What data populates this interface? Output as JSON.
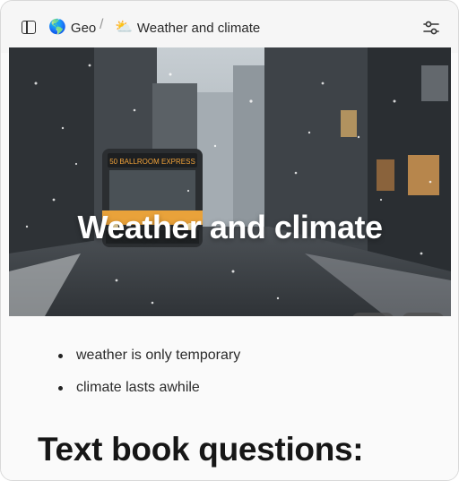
{
  "breadcrumb": {
    "items": [
      {
        "emoji": "🌎",
        "label": "Geo"
      },
      {
        "emoji": "⛅",
        "label": "Weather and climate"
      }
    ],
    "separator": "/"
  },
  "toolbar": {
    "sidebar_icon": "sidebar-toggle-icon",
    "settings_icon": "sliders-icon"
  },
  "cover": {
    "title": "Weather and climate",
    "bus_sign": "50 BALLROOM EXPRESS",
    "buttons": [
      {
        "name": "change-cover-button",
        "icon": "image-monitor-icon"
      },
      {
        "name": "theme-button",
        "icon": "palette-icon"
      }
    ]
  },
  "body": {
    "bullets": [
      "weather is only temporary",
      "climate lasts awhile"
    ],
    "heading": "Text book questions:"
  },
  "colors": {
    "background": "#fafafa",
    "bus_yellow": "#e9a23a",
    "sky": "#b9c2c9"
  }
}
